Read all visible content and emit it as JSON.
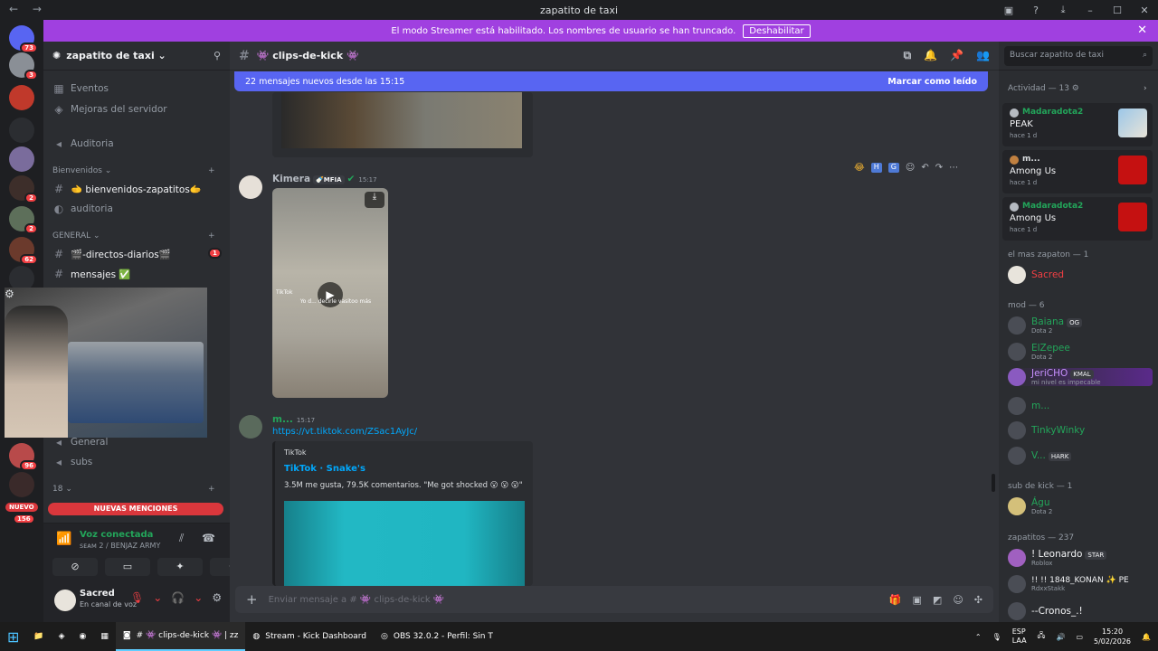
{
  "window": {
    "title": "zapatito de taxi",
    "nav": "← →"
  },
  "streamer_banner": {
    "text": "El modo Streamer está habilitado. Los nombres de usuario se han truncado.",
    "button": "Deshabilitar",
    "close": "✕"
  },
  "servers": [
    {
      "badge": "73"
    },
    {
      "badge": "3"
    },
    {
      "badge": ""
    },
    {
      "badge": ""
    },
    {
      "badge": "2"
    },
    {
      "badge": "2"
    },
    {
      "badge": "62"
    },
    {
      "badge": "96"
    }
  ],
  "sidebar": {
    "guild_name": "zapatito de taxi ⌄",
    "items": [
      {
        "label": "Eventos",
        "icon": "calendar-icon"
      },
      {
        "label": "Mejoras del servidor",
        "icon": "boost-icon"
      },
      {
        "label": "Auditoria",
        "icon": "speaker-icon"
      }
    ],
    "category_bienvenidos": "Bienvenidos ⌄",
    "ch_bienvenidos": "🫲 bienvenidos-zapatitos🫱",
    "ch_auditoria": "auditoria",
    "category_general": "GENERAL ⌄",
    "ch_directos": "🎬-directos-diarios🎬",
    "ch_directos_badge": "1",
    "ch_mensajes": "mensajes ✅",
    "ch_general": "General",
    "ch_subs": "subs",
    "category_18": "18 ⌄",
    "nuevo_badge": "NUEVO",
    "nuevo_count": "156",
    "mentions": "NUEVAS MENCIONES"
  },
  "voice": {
    "status": "Voz conectada",
    "channel": "ꜱᴇᴀᴍ 2 / BENJAZ ARMY"
  },
  "user": {
    "name": "Sacred",
    "status": "En canal de voz"
  },
  "channel": {
    "name": "👾 clips-de-kick 👾",
    "new_messages": "22 mensajes nuevos desde las 15:15",
    "mark_read": "Marcar como leído"
  },
  "messages": [
    {
      "author": "Kimera",
      "tag": "🍼MFIA",
      "time": "15:17",
      "video_caption": "Yo d... decirle vasitoo más",
      "video_brand": "TikTok"
    },
    {
      "author": "m...",
      "time": "15:17",
      "link": "https://vt.tiktok.com/ZSac1AyJc/",
      "embed_provider": "TikTok",
      "embed_title": "TikTok · Snake's",
      "embed_desc": "3.5M me gusta, 79.5K comentarios. \"Me got shocked 😮 😮 😮\""
    }
  ],
  "composer": {
    "placeholder": "Enviar mensaje a # 👾 clips-de-kick 👾"
  },
  "members": {
    "search_placeholder": "Buscar zapatito de taxi",
    "activity_header": "Actividad — 13",
    "activities": [
      {
        "user": "Madaradota2",
        "game": "PEAK",
        "ago": "hace 1 d"
      },
      {
        "user": "m...",
        "game": "Among Us",
        "ago": "hace 1 d"
      },
      {
        "user": "Madaradota2",
        "game": "Among Us",
        "ago": "hace 1 d"
      }
    ],
    "sec_zapaton": "el mas zapaton — 1",
    "sacred": "Sacred",
    "sec_mod": "mod — 6",
    "mods": [
      {
        "name": "Baiana",
        "tag": "OG",
        "sub": "Dota 2"
      },
      {
        "name": "ElZepee",
        "tag": "",
        "sub": "Dota 2"
      },
      {
        "name": "JeriCHO",
        "tag": "KMAL",
        "sub": "mi nivel es impecable"
      },
      {
        "name": "m...",
        "tag": "",
        "sub": ""
      },
      {
        "name": "TinkyWinky",
        "tag": "",
        "sub": ""
      },
      {
        "name": "V...",
        "tag": "HARK",
        "sub": ""
      }
    ],
    "sec_subkick": "sub de kick — 1",
    "subkick": {
      "name": "Águ",
      "sub": "Dota 2"
    },
    "sec_zapatitos": "zapatitos — 237",
    "zapatitos": [
      {
        "name": "! Leonardo",
        "tag": "STAR",
        "sub": "Roblox"
      },
      {
        "name": "!! !! 1848_KONAN ✨ PE",
        "tag": "",
        "sub": "RdxxStakk"
      },
      {
        "name": "--Cronos_.!",
        "tag": "",
        "sub": ""
      }
    ]
  },
  "taskbar": {
    "apps": [
      {
        "label": "# 👾 clips-de-kick 👾 | zz"
      },
      {
        "label": "Stream - Kick Dashboard"
      },
      {
        "label": "OBS 32.0.2 - Perfil: Sin T"
      }
    ],
    "lang": "ESP\nLAA",
    "time": "15:20",
    "date": "5/02/2026"
  },
  "colors": {
    "banner": "#a040e0",
    "accent": "#5865f2",
    "online": "#23a55a",
    "danger": "#f23f43"
  }
}
